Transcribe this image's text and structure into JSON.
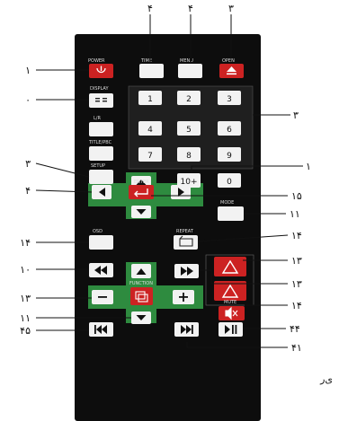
{
  "button_labels": {
    "power": "POWER",
    "time": "TIME",
    "menu": "MENU",
    "open": "OPEN",
    "display": "DISPLAY",
    "lr": "L/R",
    "title_pbc": "TITLE/PBC",
    "setup": "SETUP",
    "enter": "ENTER",
    "mode": "MODE",
    "osd": "OSD",
    "repeat": "REPEAT",
    "function": "FUNCTION",
    "mute": "MUTE"
  },
  "keypad": [
    "1",
    "2",
    "3",
    "4",
    "5",
    "6",
    "7",
    "8",
    "9",
    "10+",
    "0"
  ],
  "callouts": {
    "top_time": "۴",
    "top_menu": "۴",
    "top_open": "۳",
    "power": "۱",
    "display": "۰",
    "keypad": "۳",
    "ten_plus": "۱",
    "setup": "۳",
    "enter": "۱۵",
    "left_arrow": "۴",
    "mode": "۱۱",
    "repeat": "۱۴",
    "osd": "۱۴",
    "red_up": "۱۳",
    "rewind": "۱۰",
    "fast_forward": "۱۳",
    "minus": "۱۳",
    "mute": "۱۴",
    "function_row": "۱۱",
    "play_pause": "۴۴",
    "prev": "۴۵",
    "next": "۴۱",
    "margin_text": "ی‌ر"
  },
  "colors": {
    "remote_body": "#0d0d0d",
    "green_panel": "#2e8b3f",
    "red_button": "#cc2222",
    "white_button": "#f2f2f2",
    "grey_panel": "#1f1f1f"
  }
}
